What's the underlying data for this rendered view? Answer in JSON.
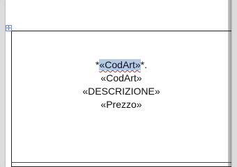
{
  "document": {
    "line1_prefix": "*",
    "line1_field": "«CodArt»",
    "line1_suffix": "*.",
    "line2": "«CodArt»",
    "line3": "«DESCRIZIONE»",
    "line4": "«Prezzo»"
  },
  "table_move_handle": {
    "icon": "move-arrows-icon",
    "glyph": "✛"
  },
  "colors": {
    "selection": "#b4cbe8",
    "spellcheck": "#d02020",
    "handle_border": "#6a8fc0"
  }
}
